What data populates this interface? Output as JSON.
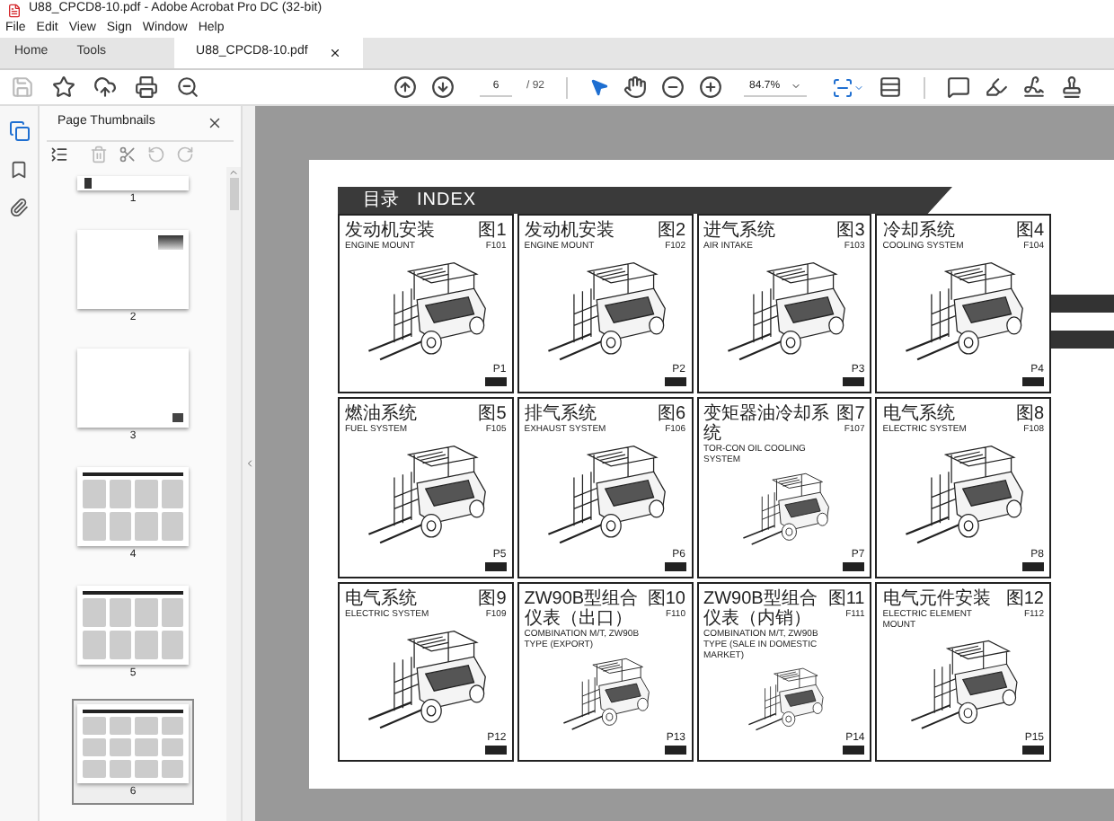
{
  "window": {
    "title": "U88_CPCD8-10.pdf - Adobe Acrobat Pro DC (32-bit)"
  },
  "menu": [
    "File",
    "Edit",
    "View",
    "Sign",
    "Window",
    "Help"
  ],
  "tabs": [
    {
      "label": "Home",
      "selected": false
    },
    {
      "label": "Tools",
      "selected": false
    },
    {
      "label": "U88_CPCD8-10.pdf",
      "selected": true
    }
  ],
  "toolbar": {
    "page": "6",
    "page_total": "/ 92",
    "zoom": "84.7%"
  },
  "sidebar": {
    "title": "Page Thumbnails",
    "thumbnails": [
      {
        "label": "1",
        "selected": false
      },
      {
        "label": "2",
        "selected": false
      },
      {
        "label": "3",
        "selected": false
      },
      {
        "label": "4",
        "selected": false
      },
      {
        "label": "5",
        "selected": false
      },
      {
        "label": "6",
        "selected": true
      }
    ]
  },
  "document": {
    "heading_cn": "目录",
    "heading_en": "INDEX",
    "cells": [
      {
        "title_cn": "发动机安装",
        "title_en": "ENGINE MOUNT",
        "fig": "图1",
        "code": "F101",
        "page": "P1"
      },
      {
        "title_cn": "发动机安装",
        "title_en": "ENGINE MOUNT",
        "fig": "图2",
        "code": "F102",
        "page": "P2"
      },
      {
        "title_cn": "进气系统",
        "title_en": "AIR INTAKE",
        "fig": "图3",
        "code": "F103",
        "page": "P3"
      },
      {
        "title_cn": "冷却系统",
        "title_en": "COOLING SYSTEM",
        "fig": "图4",
        "code": "F104",
        "page": "P4"
      },
      {
        "title_cn": "燃油系统",
        "title_en": "FUEL SYSTEM",
        "fig": "图5",
        "code": "F105",
        "page": "P5"
      },
      {
        "title_cn": "排气系统",
        "title_en": "EXHAUST SYSTEM",
        "fig": "图6",
        "code": "F106",
        "page": "P6"
      },
      {
        "title_cn": "变矩器油冷却系统",
        "title_en": "TOR-CON OIL COOLING SYSTEM",
        "fig": "图7",
        "code": "F107",
        "page": "P7"
      },
      {
        "title_cn": "电气系统",
        "title_en": "ELECTRIC SYSTEM",
        "fig": "图8",
        "code": "F108",
        "page": "P8"
      },
      {
        "title_cn": "电气系统",
        "title_en": "ELECTRIC SYSTEM",
        "fig": "图9",
        "code": "F109",
        "page": "P12"
      },
      {
        "title_cn": "ZW90B型组合仪表（出口）",
        "title_en": "COMBINATION M/T, ZW90B TYPE (EXPORT)",
        "fig": "图10",
        "code": "F110",
        "page": "P13"
      },
      {
        "title_cn": "ZW90B型组合仪表（内销）",
        "title_en": "COMBINATION M/T, ZW90B TYPE (SALE IN DOMESTIC MARKET)",
        "fig": "图11",
        "code": "F111",
        "page": "P14"
      },
      {
        "title_cn": "电气元件安装",
        "title_en": "ELECTRIC ELEMENT MOUNT",
        "fig": "图12",
        "code": "F112",
        "page": "P15"
      }
    ]
  }
}
